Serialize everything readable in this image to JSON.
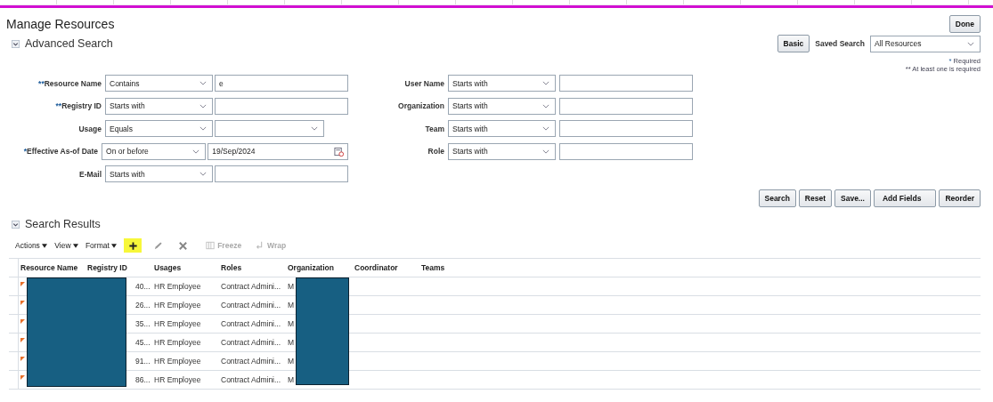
{
  "page": {
    "title": "Manage Resources",
    "done_button": "Done"
  },
  "advanced_search": {
    "title": "Advanced Search",
    "expanded": true,
    "basic_button": "Basic",
    "saved_search_label": "Saved Search",
    "saved_search_value": "All Resources",
    "required_note": "Required",
    "required_mark": "*",
    "at_least_one_note": "** At least one is required",
    "left_fields": [
      {
        "kind": "text",
        "mark": "**",
        "label": "Resource Name",
        "operator": "Contains",
        "value": "e"
      },
      {
        "kind": "text",
        "mark": "**",
        "label": "Registry ID",
        "operator": "Starts with"
      },
      {
        "kind": "choice",
        "label": "Usage",
        "operator": "Equals"
      },
      {
        "kind": "date",
        "mark": "*",
        "label": "Effective As-of Date",
        "operator": "On or before",
        "value": "19/Sep/2024"
      },
      {
        "kind": "text",
        "label": "E-Mail",
        "operator": "Starts with"
      }
    ],
    "right_fields": [
      {
        "kind": "text",
        "label": "User Name",
        "operator": "Starts with"
      },
      {
        "kind": "text",
        "label": "Organization",
        "operator": "Starts with"
      },
      {
        "kind": "text",
        "label": "Team",
        "operator": "Starts with"
      },
      {
        "kind": "text",
        "label": "Role",
        "operator": "Starts with"
      }
    ],
    "buttons": [
      "Search",
      "Reset",
      "Save...",
      "Add Fields",
      "Reorder"
    ]
  },
  "search_results": {
    "title": "Search Results",
    "expanded": true,
    "menus": [
      "Actions",
      "View",
      "Format"
    ],
    "tools": [
      {
        "kind": "add",
        "highlighted": true,
        "disabled": false
      },
      {
        "kind": "edit",
        "highlighted": false,
        "disabled": false
      },
      {
        "kind": "delete",
        "highlighted": false,
        "disabled": false
      }
    ],
    "toggles": [
      {
        "kind": "freeze",
        "label": "Freeze",
        "disabled": true
      },
      {
        "kind": "wrap",
        "label": "Wrap",
        "disabled": true
      }
    ],
    "columns": [
      "Resource Name",
      "Registry ID",
      "Usages",
      "Roles",
      "Organization",
      "Coordinator",
      "Teams"
    ],
    "rows": [
      {
        "registry_id": "40...",
        "usages": "HR Employee",
        "roles": "Contract Admini...",
        "organization": "M"
      },
      {
        "registry_id": "26...",
        "usages": "HR Employee",
        "roles": "Contract Admini...",
        "organization": "M"
      },
      {
        "registry_id": "35...",
        "usages": "HR Employee",
        "roles": "Contract Admini...",
        "organization": "M"
      },
      {
        "registry_id": "45...",
        "usages": "HR Employee",
        "roles": "Contract Admini...",
        "organization": "M"
      },
      {
        "registry_id": "91...",
        "usages": "HR Employee",
        "roles": "Contract Admini...",
        "organization": "M"
      },
      {
        "registry_id": "86...",
        "usages": "HR Employee",
        "roles": "Contract Admini...",
        "organization": "M"
      }
    ]
  }
}
